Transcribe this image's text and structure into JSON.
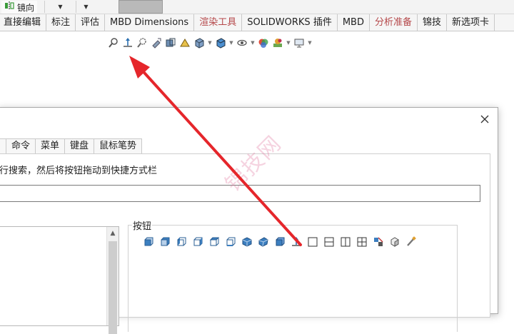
{
  "top_strip": {
    "mirror_label": "镜向"
  },
  "tabs": [
    {
      "label": "直接编辑",
      "color": "normal"
    },
    {
      "label": "标注",
      "color": "normal"
    },
    {
      "label": "评估",
      "color": "normal"
    },
    {
      "label": "MBD Dimensions",
      "color": "normal"
    },
    {
      "label": "渲染工具",
      "color": "red"
    },
    {
      "label": "SOLIDWORKS 插件",
      "color": "normal"
    },
    {
      "label": "MBD",
      "color": "normal"
    },
    {
      "label": "分析准备",
      "color": "red"
    },
    {
      "label": "锦技",
      "color": "normal"
    },
    {
      "label": "新选项卡",
      "color": "normal"
    }
  ],
  "dialog": {
    "tabs": [
      "命令",
      "菜单",
      "键盘",
      "鼠标笔势"
    ],
    "instruction": "行搜索，然后将按钮拖动到快捷方式栏",
    "search_value": "",
    "buttons_group_label": "按钮"
  },
  "watermark": "锦技网",
  "colors": {
    "arrow": "#e5262b",
    "tab_red": "#b5484a",
    "icon_blue": "#3c7fc0"
  }
}
